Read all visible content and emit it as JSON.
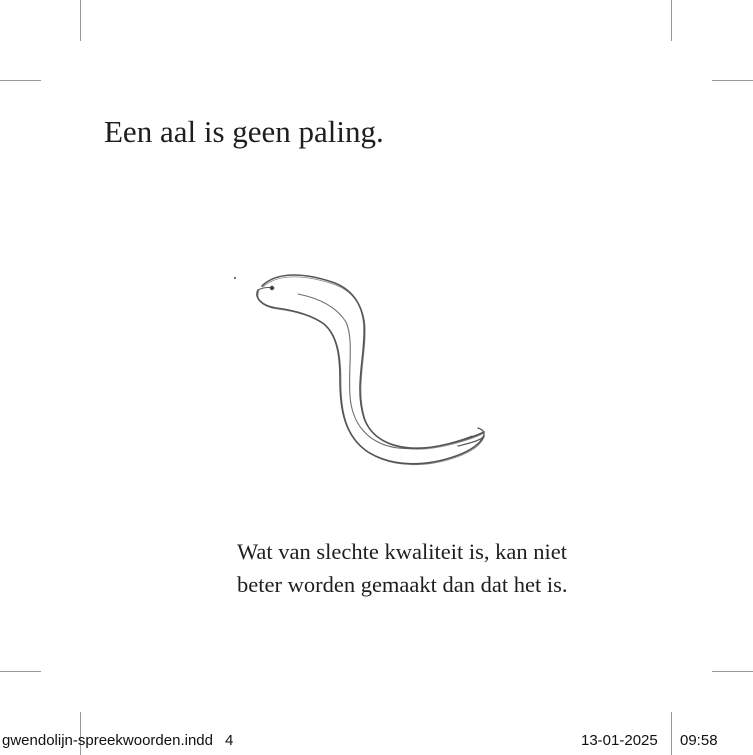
{
  "page": {
    "title": "Een aal is geen paling.",
    "caption_lines": [
      "Wat van slechte kwaliteit is, kan niet",
      "beter worden gemaakt dan dat het is."
    ],
    "illustration_icon": "eel-icon"
  },
  "slug": {
    "filename": "gwendolijn-spreekwoorden.indd",
    "page_number": "4",
    "date": "13-01-2025",
    "time": "09:58"
  },
  "colors": {
    "text": "#1e1e1e",
    "crop_marks": "#9a9a9a",
    "drawing": "#555555"
  }
}
